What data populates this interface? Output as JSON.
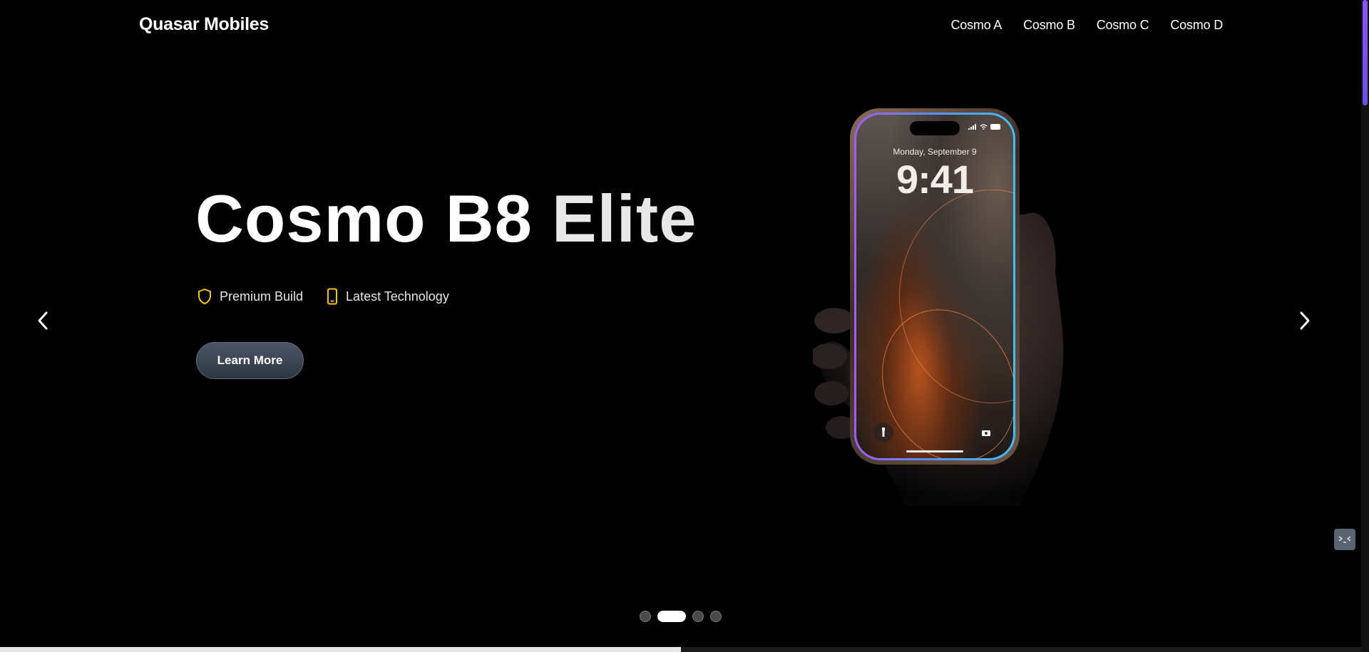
{
  "header": {
    "brand": "Quasar Mobiles",
    "nav": [
      "Cosmo A",
      "Cosmo B",
      "Cosmo C",
      "Cosmo D"
    ]
  },
  "hero": {
    "title_part1": "Cosmo B8",
    "title_part2": "Elite",
    "features": [
      {
        "icon": "shield-icon",
        "label": "Premium Build"
      },
      {
        "icon": "phone-icon",
        "label": "Latest Technology"
      }
    ],
    "cta_label": "Learn More"
  },
  "phone_screen": {
    "date": "Monday, September 9",
    "time": "9:41"
  },
  "carousel": {
    "slide_count": 4,
    "active_index": 1,
    "progress": 0.5
  },
  "colors": {
    "background": "#000000",
    "feature_icon": "#f5c518",
    "cta_bg": "#3b4452",
    "scroll_thumb": "#7b52f5"
  }
}
